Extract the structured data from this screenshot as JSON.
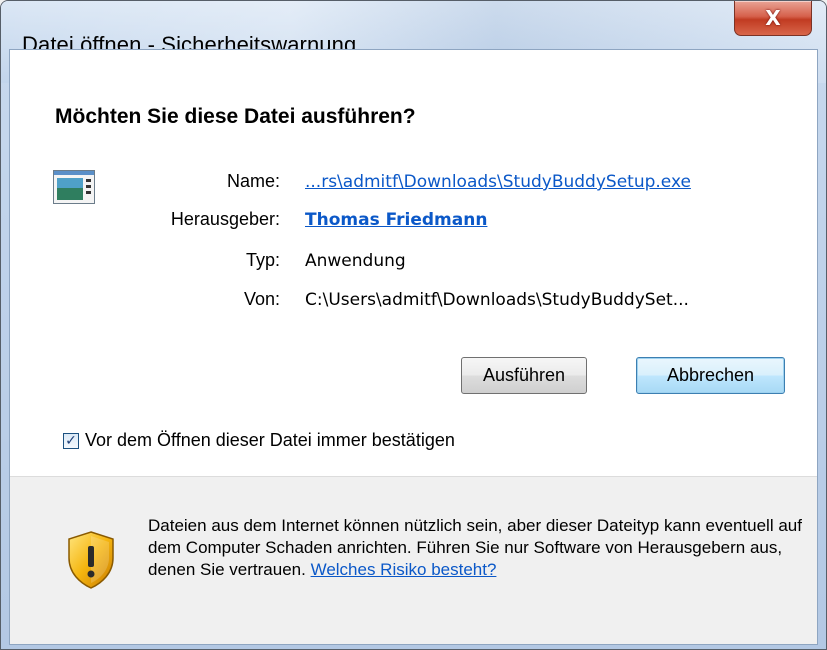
{
  "window": {
    "title": "Datei öffnen - Sicherheitswarnung",
    "close_glyph": "X"
  },
  "dialog": {
    "question": "Möchten Sie diese Datei ausführen?",
    "icon": "application-icon",
    "fields": {
      "name_label": "Name:",
      "name_value": "...rs\\admitf\\Downloads\\StudyBuddySetup.exe",
      "publisher_label": "Herausgeber:",
      "publisher_value": "Thomas Friedmann",
      "type_label": "Typ:",
      "type_value": "Anwendung",
      "from_label": "Von:",
      "from_value": "C:\\Users\\admitf\\Downloads\\StudyBuddySet..."
    },
    "buttons": {
      "run": "Ausführen",
      "cancel": "Abbrechen"
    },
    "checkbox": {
      "label": "Vor dem Öffnen dieser Datei immer bestätigen",
      "checked": true,
      "check_glyph": "✓"
    },
    "warning": {
      "icon": "shield-warning-icon",
      "text": "Dateien aus dem Internet können nützlich sein, aber dieser Dateityp kann eventuell auf dem Computer Schaden anrichten. Führen Sie nur Software von Herausgebern aus, denen Sie vertrauen.",
      "link": "Welches Risiko besteht?"
    }
  },
  "colors": {
    "link": "#0b58c8",
    "close_button": "#c13b22"
  }
}
